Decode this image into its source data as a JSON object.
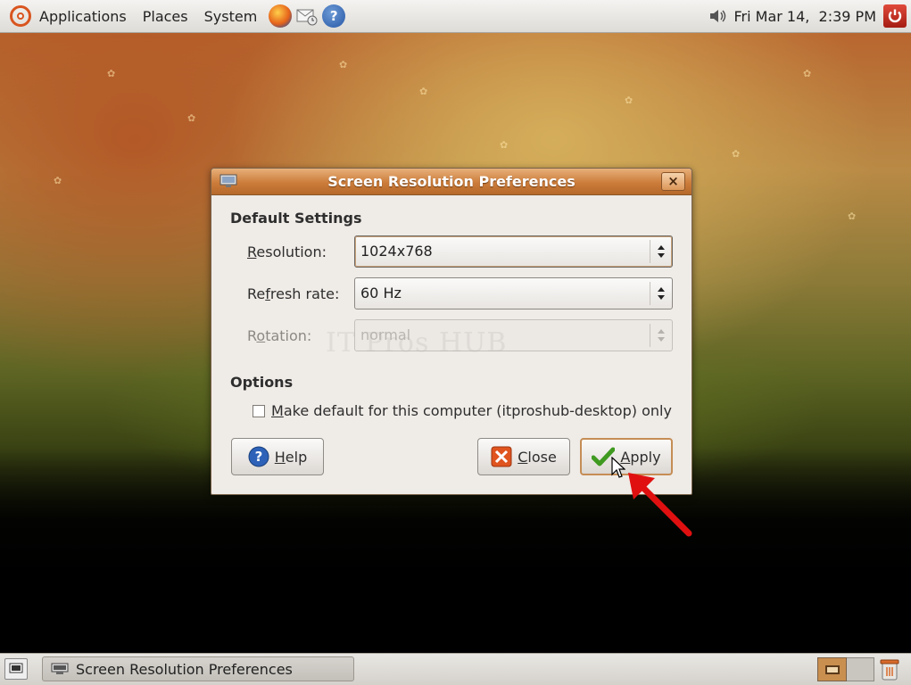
{
  "top_panel": {
    "menus": [
      "Applications",
      "Places",
      "System"
    ],
    "clock": "Fri Mar 14,  2:39 PM",
    "icons": [
      "ubuntu-logo-icon",
      "firefox-icon",
      "mail-icon",
      "help-icon",
      "volume-icon",
      "power-icon"
    ]
  },
  "dialog": {
    "title": "Screen Resolution Preferences",
    "close_glyph": "×",
    "default_settings_heading": "Default Settings",
    "resolution": {
      "mnemonic": "R",
      "rest": "esolution:",
      "value": "1024x768"
    },
    "refresh": {
      "before": "Re",
      "mnemonic": "f",
      "after": "resh rate:",
      "value": "60 Hz"
    },
    "rotation": {
      "before": "R",
      "mnemonic": "o",
      "after": "tation:",
      "value": "normal"
    },
    "options_heading": "Options",
    "make_default": {
      "mnemonic": "M",
      "rest": "ake default for this computer (itproshub-desktop) only",
      "checked": false
    },
    "help_button": {
      "mnemonic": "H",
      "rest": "elp"
    },
    "close_button": {
      "mnemonic": "C",
      "rest": "lose"
    },
    "apply_button": {
      "mnemonic": "A",
      "rest": "pply"
    },
    "watermark": "IT Pros HUB"
  },
  "bottom_panel": {
    "task": "Screen Resolution Preferences"
  },
  "colors": {
    "title_bar": "#cc7c3a",
    "dialog_bg": "#efebe7",
    "annotation_arrow": "#e01010"
  }
}
